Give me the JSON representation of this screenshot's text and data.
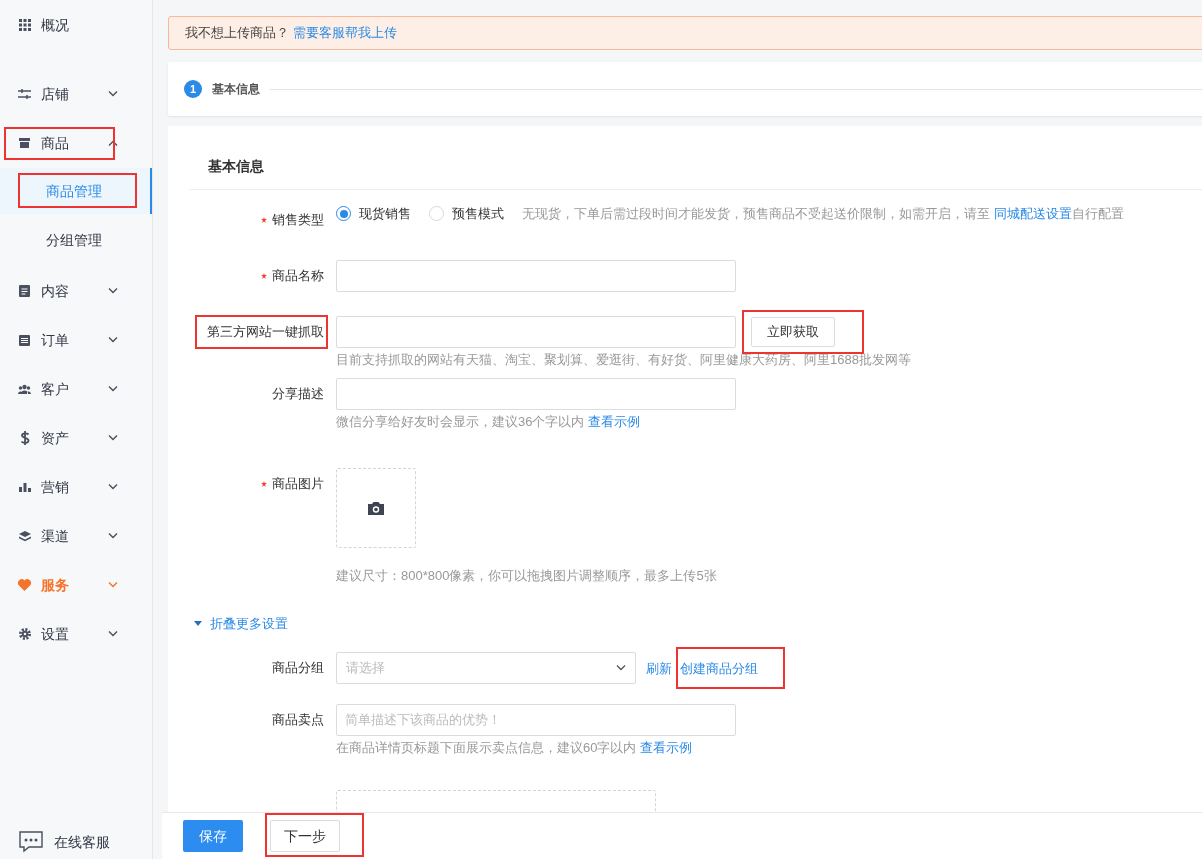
{
  "sidebar": {
    "items": [
      {
        "label": "概况",
        "emphasized": false
      },
      {
        "label": "店铺",
        "expanded": false,
        "emphasized": false
      },
      {
        "label": "商品",
        "expanded": true,
        "emphasized": false,
        "annotated": true,
        "children": [
          {
            "label": "商品管理",
            "selected": true,
            "annotated": true
          },
          {
            "label": "分组管理",
            "selected": false,
            "annotated": false
          }
        ]
      },
      {
        "label": "内容",
        "expanded": false,
        "emphasized": false
      },
      {
        "label": "订单",
        "expanded": false,
        "emphasized": false
      },
      {
        "label": "客户",
        "expanded": false,
        "emphasized": false
      },
      {
        "label": "资产",
        "expanded": false,
        "emphasized": false
      },
      {
        "label": "营销",
        "expanded": false,
        "emphasized": false
      },
      {
        "label": "渠道",
        "expanded": false,
        "emphasized": false
      },
      {
        "label": "服务",
        "expanded": false,
        "emphasized": true
      },
      {
        "label": "设置",
        "expanded": false,
        "emphasized": false
      }
    ],
    "support": {
      "label": "在线客服"
    }
  },
  "notice": {
    "text": "我不想上传商品？",
    "link": "需要客服帮我上传"
  },
  "steps": [
    {
      "number": "1",
      "label": "基本信息",
      "selected": true
    }
  ],
  "form": {
    "section_title": "基本信息",
    "rows": [
      {
        "kind": "radio",
        "label": "销售类型",
        "required": true,
        "options": [
          {
            "label": "现货销售",
            "selected": true
          },
          {
            "label": "预售模式",
            "selected": false
          }
        ],
        "hint": {
          "text": "无现货，下单后需过段时间才能发货，预售商品不受起送价限制，如需开启，请至 ",
          "link": "同城配送设置",
          "tail": "自行配置"
        }
      },
      {
        "kind": "text",
        "label": "商品名称",
        "required": true
      },
      {
        "kind": "text",
        "label": "第三方网站一键抓取",
        "required": false,
        "annotated": true,
        "button": {
          "label": "立即获取",
          "annotated": true
        },
        "hint": {
          "text": "目前支持抓取的网站有天猫、淘宝、聚划算、爱逛街、有好货、阿里健康大药房、阿里1688批发网等"
        }
      },
      {
        "kind": "text",
        "label": "分享描述",
        "required": false,
        "hint": {
          "text": "微信分享给好友时会显示，建议36个字以内 ",
          "link": "查看示例"
        }
      },
      {
        "kind": "image",
        "label": "商品图片",
        "required": true,
        "hint": {
          "text": "建议尺寸：800*800像素，你可以拖拽图片调整顺序，最多上传5张"
        }
      }
    ],
    "more_settings": {
      "label": "折叠更多设置",
      "expanded": true,
      "rows": [
        {
          "kind": "select",
          "label": "商品分组",
          "placeholder": "请选择",
          "links": [
            {
              "label": "刷新",
              "annotated": false
            },
            {
              "label": "创建商品分组",
              "annotated": true
            }
          ]
        },
        {
          "kind": "text",
          "label": "商品卖点",
          "placeholder": "简单描述下该商品的优势！",
          "hint": {
            "text": "在商品详情页标题下面展示卖点信息，建议60字以内 ",
            "link": "查看示例"
          }
        },
        {
          "kind": "video"
        }
      ]
    }
  },
  "footer": {
    "buttons": [
      {
        "label": "保存",
        "kind": "primary"
      },
      {
        "label": "下一步",
        "kind": "default",
        "annotated": true
      }
    ]
  }
}
